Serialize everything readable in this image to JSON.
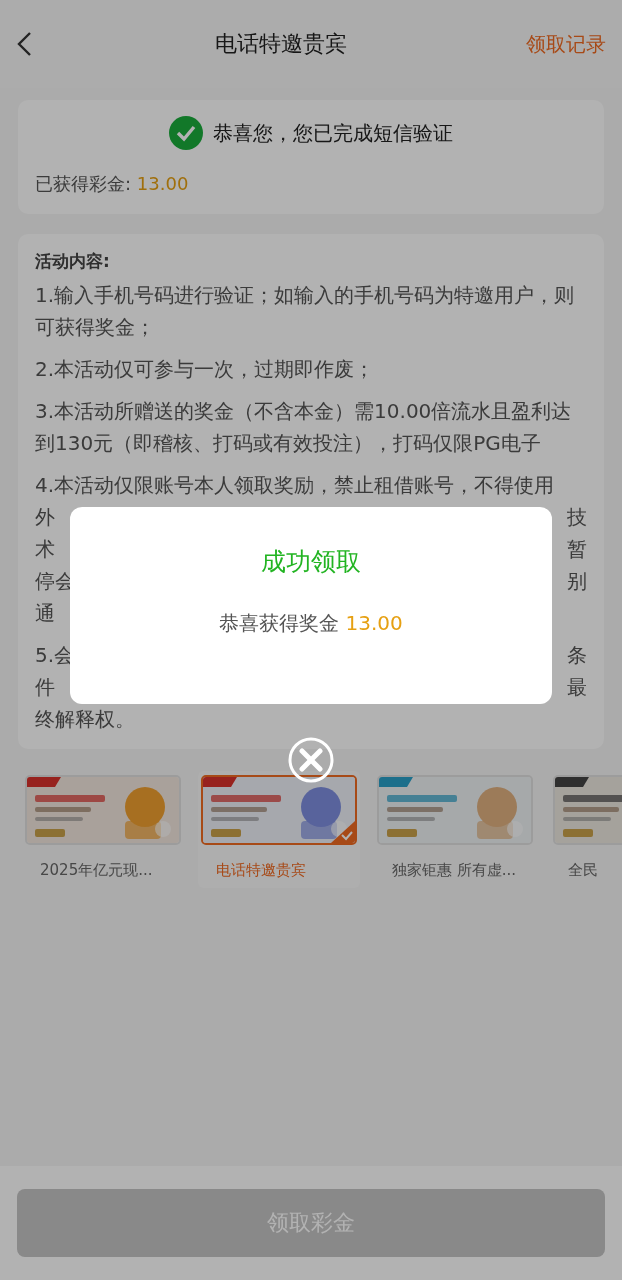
{
  "header": {
    "title": "电话特邀贵宾",
    "action": "领取记录"
  },
  "verify": {
    "message": "恭喜您，您已完成短信验证",
    "bonus_label": "已获得彩金:",
    "bonus_value": "13.00"
  },
  "rules": {
    "heading": "活动内容:",
    "items": [
      {
        "kind": "text",
        "text": "1.输入手机号码进行验证；如输入的手机号码为特邀用户，则可获得奖金；"
      },
      {
        "kind": "text",
        "text": "2.本活动仅可参与一次，过期即作废；"
      },
      {
        "kind": "text",
        "text": "3.本活动所赠送的奖金（不含本金）需10.00倍流水且盈利达到130元（即稽核、打码或有效投注），打码仅限PG电子"
      },
      {
        "kind": "covered",
        "lines": [
          {
            "left": "4.本活动仅限账号本人领取奖励，禁止租借账号，不得使用"
          },
          {
            "left": "外",
            "right": "技"
          },
          {
            "left": "术",
            "right": "暂"
          },
          {
            "left": "停会",
            "right": "别"
          },
          {
            "left": "通"
          }
        ]
      },
      {
        "kind": "covered",
        "lines": [
          {
            "left": "5.会",
            "right": "条"
          },
          {
            "left": "件",
            "right": "最"
          },
          {
            "left": "终解释权。"
          }
        ]
      }
    ]
  },
  "promos": [
    {
      "label": "2025年亿元现...",
      "selected": false
    },
    {
      "label": "电话特邀贵宾",
      "selected": true
    },
    {
      "label": "独家钜惠 所有虚...",
      "selected": false
    },
    {
      "label": "全民",
      "selected": false
    }
  ],
  "claim_button": "领取彩金",
  "dialog": {
    "title": "成功领取",
    "message": "恭喜获得奖金",
    "amount": "13.00"
  }
}
